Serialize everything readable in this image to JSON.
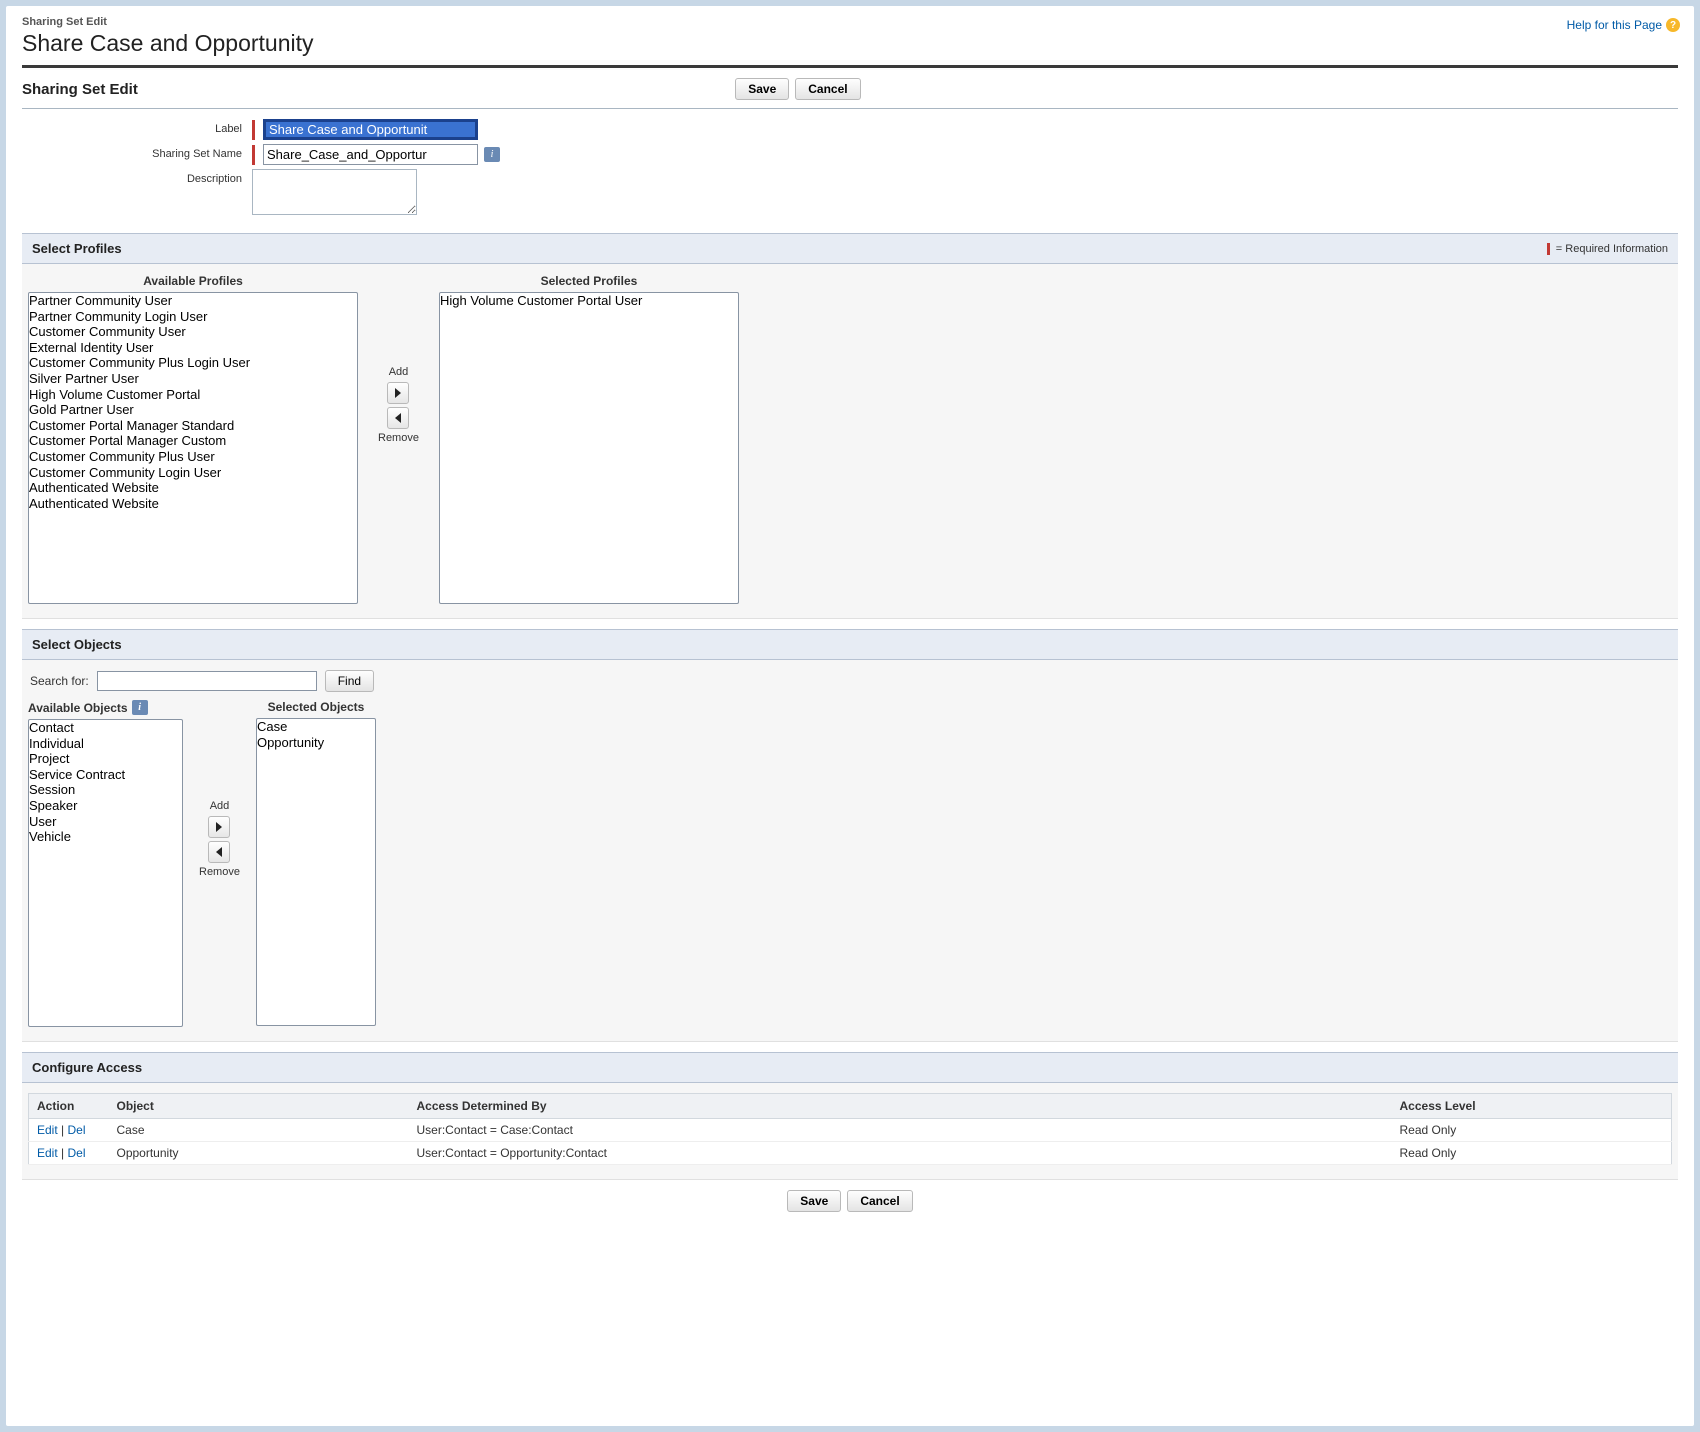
{
  "help": {
    "label": "Help for this Page"
  },
  "pageHead": {
    "sub": "Sharing Set Edit",
    "title": "Share Case and Opportunity"
  },
  "buttons": {
    "save": "Save",
    "cancel": "Cancel"
  },
  "form": {
    "labelField": {
      "label": "Label",
      "value": "Share Case and Opportunit"
    },
    "nameField": {
      "label": "Sharing Set Name",
      "value": "Share_Case_and_Opportur"
    },
    "description": {
      "label": "Description",
      "value": ""
    }
  },
  "sections": {
    "sharingSetEdit": "Sharing Set Edit",
    "selectProfiles": "Select Profiles",
    "selectObjects": "Select Objects",
    "configureAccess": "Configure Access"
  },
  "requiredLegend": "= Required Information",
  "profiles": {
    "availableLabel": "Available Profiles",
    "selectedLabel": "Selected Profiles",
    "add": "Add",
    "remove": "Remove",
    "available": [
      "Partner Community User",
      "Partner Community Login User",
      "Customer Community User",
      "External Identity User",
      "Customer Community Plus Login User",
      "Silver Partner User",
      "High Volume Customer Portal",
      "Gold Partner User",
      "Customer Portal Manager Standard",
      "Customer Portal Manager Custom",
      "Customer Community Plus User",
      "Customer Community Login User",
      "Authenticated Website",
      "Authenticated Website"
    ],
    "selected": [
      "High Volume Customer Portal User"
    ]
  },
  "objects": {
    "searchLabel": "Search  for:",
    "find": "Find",
    "availableLabel": "Available Objects",
    "selectedLabel": "Selected Objects",
    "add": "Add",
    "remove": "Remove",
    "available": [
      "Contact",
      "Individual",
      "Project",
      "Service Contract",
      "Session",
      "Speaker",
      "User",
      "Vehicle"
    ],
    "selected": [
      "Case",
      "Opportunity"
    ]
  },
  "access": {
    "columns": {
      "action": "Action",
      "object": "Object",
      "by": "Access Determined By",
      "level": "Access Level"
    },
    "actions": {
      "edit": "Edit",
      "del": "Del"
    },
    "rows": [
      {
        "object": "Case",
        "by": "User:Contact = Case:Contact",
        "level": "Read Only"
      },
      {
        "object": "Opportunity",
        "by": "User:Contact = Opportunity:Contact",
        "level": "Read Only"
      }
    ]
  }
}
